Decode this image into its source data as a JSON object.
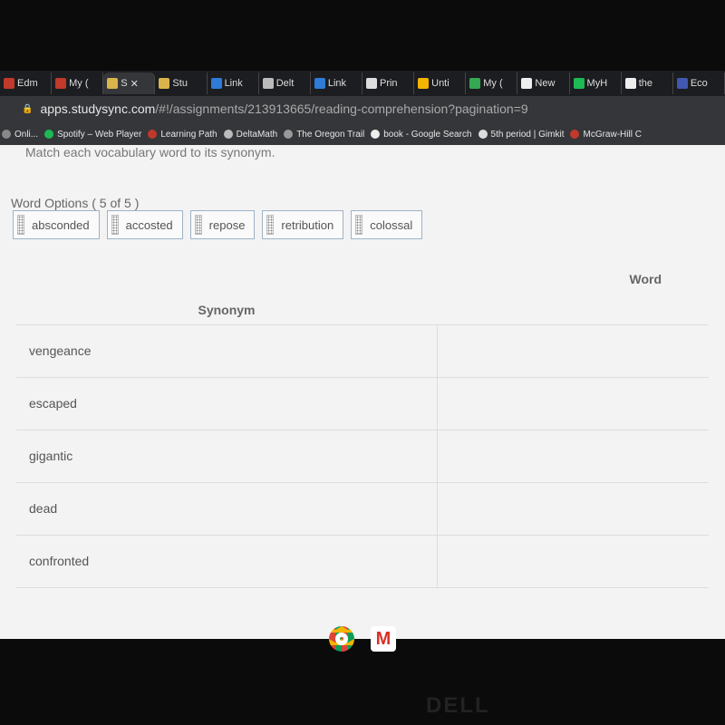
{
  "browser": {
    "tabs": [
      {
        "label": "Edm",
        "icon": "edmentum-icon",
        "color": "#c0392b"
      },
      {
        "label": "My (",
        "icon": "mcgraw-hill-icon",
        "color": "#c0392b"
      },
      {
        "label": "S",
        "icon": "studysync-icon",
        "color": "#d9b44a",
        "active": true
      },
      {
        "label": "Stu",
        "icon": "studysync-icon",
        "color": "#d9b44a"
      },
      {
        "label": "Link",
        "icon": "link-icon",
        "color": "#2f7bd8"
      },
      {
        "label": "Delt",
        "icon": "deltamath-icon",
        "color": "#bbbbbb"
      },
      {
        "label": "Link",
        "icon": "link-icon",
        "color": "#2f7bd8"
      },
      {
        "label": "Prin",
        "icon": "gw-icon",
        "color": "#dddddd"
      },
      {
        "label": "Unti",
        "icon": "slides-icon",
        "color": "#f4b400"
      },
      {
        "label": "My (",
        "icon": "drive-icon",
        "color": "#34a853"
      },
      {
        "label": "New",
        "icon": "chrome-icon",
        "color": "#eeeeee"
      },
      {
        "label": "MyH",
        "icon": "spotify-icon",
        "color": "#1db954"
      },
      {
        "label": "the",
        "icon": "google-icon",
        "color": "#eeeeee"
      },
      {
        "label": "Eco",
        "icon": "quizlet-icon",
        "color": "#4257b2"
      }
    ],
    "close_glyph": "✕",
    "url_host": "apps.studysync.com",
    "url_path": "/#!/assignments/213913665/reading-comprehension?pagination=9",
    "bookmarks": [
      {
        "label": "Onli...",
        "icon": "bookmark-icon",
        "color": "#888888"
      },
      {
        "label": "Spotify – Web Player",
        "icon": "spotify-icon",
        "color": "#1db954"
      },
      {
        "label": "Learning Path",
        "icon": "edmentum-icon",
        "color": "#c0392b"
      },
      {
        "label": "DeltaMath",
        "icon": "deltamath-icon",
        "color": "#bbbbbb"
      },
      {
        "label": "The Oregon Trail",
        "icon": "oregon-trail-icon",
        "color": "#999999"
      },
      {
        "label": "book - Google Search",
        "icon": "google-icon",
        "color": "#eeeeee"
      },
      {
        "label": "5th period | Gimkit",
        "icon": "gimkit-icon",
        "color": "#dddddd"
      },
      {
        "label": "McGraw-Hill C",
        "icon": "mcgraw-hill-icon",
        "color": "#c0392b"
      }
    ]
  },
  "page": {
    "instruction": "Match each vocabulary word to its synonym.",
    "word_options_label": "Word Options ( 5 of 5 )",
    "word_options": [
      "absconded",
      "accosted",
      "repose",
      "retribution",
      "colossal"
    ],
    "table": {
      "headers": {
        "synonym": "Synonym",
        "word": "Word"
      },
      "rows": [
        "vengeance",
        "escaped",
        "gigantic",
        "dead",
        "confronted"
      ]
    }
  },
  "taskbar": [
    {
      "icon": "chrome-icon"
    },
    {
      "icon": "gmail-icon"
    }
  ],
  "device_logo": "DELL"
}
